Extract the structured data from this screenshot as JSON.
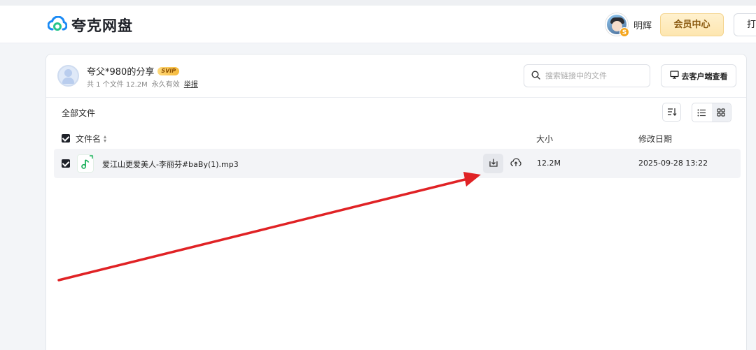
{
  "app": {
    "logo_text": "夸克网盘"
  },
  "header": {
    "username": "明辉",
    "avatar_badge": "S",
    "vip_button": "会员中心",
    "open_button": "打"
  },
  "share": {
    "title": "夸父*980的分享",
    "badge": "SVIP",
    "meta_count": "共 1 个文件 12.2M",
    "meta_validity": "永久有效",
    "report_link": "举报",
    "search_placeholder": "搜索链接中的文件",
    "client_button": "去客户端查看"
  },
  "toolbar": {
    "breadcrumb": "全部文件"
  },
  "table": {
    "columns": {
      "name": "文件名",
      "size": "大小",
      "date": "修改日期"
    },
    "rows": [
      {
        "name": "爱江山更爱美人-李丽芬#baBy(1).mp3",
        "size": "12.2M",
        "date": "2025-09-28 13:22",
        "checked": true
      }
    ]
  },
  "colors": {
    "accent": "#0d78f2",
    "vip_gold": "#f6b93b",
    "annotation_arrow": "#e02225",
    "audio_icon": "#18b05a"
  },
  "icons": [
    "cloud-logo-icon",
    "search-icon",
    "monitor-icon",
    "sort-icon",
    "list-view-icon",
    "grid-view-icon",
    "music-file-icon",
    "download-icon",
    "cloud-save-icon"
  ]
}
